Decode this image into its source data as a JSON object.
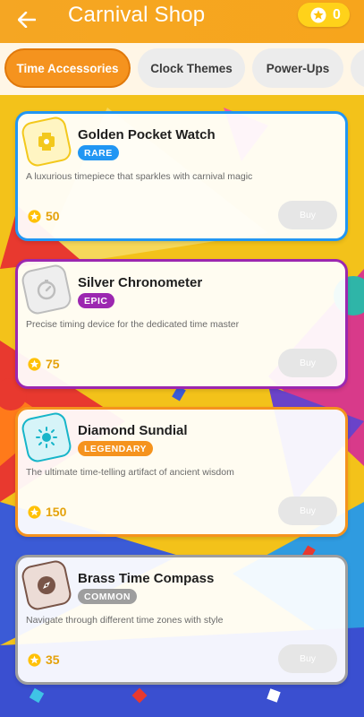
{
  "header": {
    "title": "Carnival Shop",
    "back_icon": "arrow-left-icon",
    "coins": "0"
  },
  "tabs": [
    {
      "label": "Time Accessories",
      "active": true
    },
    {
      "label": "Clock Themes",
      "active": false
    },
    {
      "label": "Power-Ups",
      "active": false
    }
  ],
  "items": [
    {
      "name": "Golden Pocket Watch",
      "rarity": "RARE",
      "rarity_color": "#2196f3",
      "description": "A luxurious timepiece that sparkles with carnival magic",
      "price": "50",
      "buy_label": "Buy",
      "icon": "watch-icon",
      "icon_color": "#f3c81c",
      "icon_bg": "#fff5c2"
    },
    {
      "name": "Silver Chronometer",
      "rarity": "EPIC",
      "rarity_color": "#9c27b0",
      "description": "Precise timing device for the dedicated time master",
      "price": "75",
      "buy_label": "Buy",
      "icon": "stopwatch-icon",
      "icon_color": "#bdbdbd",
      "icon_bg": "#eeeeee"
    },
    {
      "name": "Diamond Sundial",
      "rarity": "LEGENDARY",
      "rarity_color": "#f5931e",
      "description": "The ultimate time-telling artifact of ancient wisdom",
      "price": "150",
      "buy_label": "Buy",
      "icon": "sun-icon",
      "icon_color": "#17b5c9",
      "icon_bg": "#d6f4f8"
    },
    {
      "name": "Brass Time Compass",
      "rarity": "COMMON",
      "rarity_color": "#9e9e9e",
      "description": "Navigate through different time zones with style",
      "price": "35",
      "buy_label": "Buy",
      "icon": "compass-icon",
      "icon_color": "#795548",
      "icon_bg": "#ecdcd6"
    }
  ],
  "colors": {
    "header": "#f5a623",
    "accent": "#f5931e",
    "price": "#e4a20c"
  }
}
